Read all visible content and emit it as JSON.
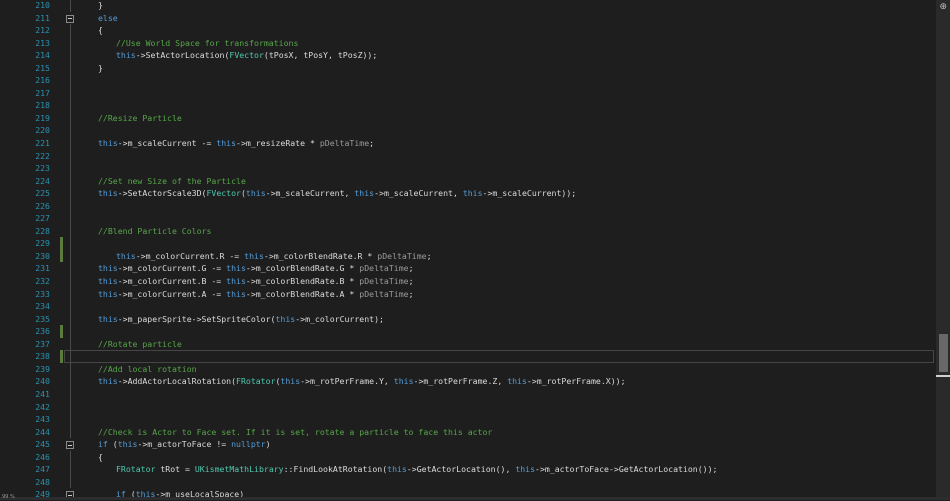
{
  "editor": {
    "lines": [
      {
        "n": "210",
        "fold": "",
        "guide": true,
        "changed": false,
        "current": false,
        "indent": 0,
        "tokens": [
          [
            "p",
            "}"
          ]
        ]
      },
      {
        "n": "211",
        "fold": "-",
        "guide": false,
        "changed": false,
        "current": false,
        "indent": 0,
        "tokens": [
          [
            "k",
            "else"
          ]
        ]
      },
      {
        "n": "212",
        "fold": "",
        "guide": true,
        "changed": false,
        "current": false,
        "indent": 0,
        "tokens": [
          [
            "p",
            "{"
          ]
        ]
      },
      {
        "n": "213",
        "fold": "",
        "guide": true,
        "changed": false,
        "current": false,
        "indent": 1,
        "tokens": [
          [
            "c",
            "//Use World Space for transformations"
          ]
        ]
      },
      {
        "n": "214",
        "fold": "",
        "guide": true,
        "changed": false,
        "current": false,
        "indent": 1,
        "tokens": [
          [
            "k",
            "this"
          ],
          [
            "p",
            "->"
          ],
          [
            "f",
            "SetActorLocation"
          ],
          [
            "p",
            "("
          ],
          [
            "t",
            "FVector"
          ],
          [
            "p",
            "(tPosX, tPosY, tPosZ));"
          ]
        ]
      },
      {
        "n": "215",
        "fold": "",
        "guide": true,
        "changed": false,
        "current": false,
        "indent": 0,
        "tokens": [
          [
            "p",
            "}"
          ]
        ]
      },
      {
        "n": "216",
        "fold": "",
        "guide": true,
        "changed": false,
        "current": false,
        "indent": 0,
        "tokens": []
      },
      {
        "n": "217",
        "fold": "",
        "guide": true,
        "changed": false,
        "current": false,
        "indent": 0,
        "tokens": []
      },
      {
        "n": "218",
        "fold": "",
        "guide": true,
        "changed": false,
        "current": false,
        "indent": 0,
        "tokens": []
      },
      {
        "n": "219",
        "fold": "",
        "guide": true,
        "changed": false,
        "current": false,
        "indent": 0,
        "tokens": [
          [
            "c",
            "//Resize Particle"
          ]
        ]
      },
      {
        "n": "220",
        "fold": "",
        "guide": true,
        "changed": false,
        "current": false,
        "indent": 0,
        "tokens": []
      },
      {
        "n": "221",
        "fold": "",
        "guide": true,
        "changed": false,
        "current": false,
        "indent": 0,
        "tokens": [
          [
            "k",
            "this"
          ],
          [
            "p",
            "->"
          ],
          [
            "m",
            "m_scaleCurrent"
          ],
          [
            "p",
            " -= "
          ],
          [
            "k",
            "this"
          ],
          [
            "p",
            "->"
          ],
          [
            "m",
            "m_resizeRate"
          ],
          [
            "p",
            " * "
          ],
          [
            "a",
            "pDeltaTime"
          ],
          [
            "p",
            ";"
          ]
        ]
      },
      {
        "n": "222",
        "fold": "",
        "guide": true,
        "changed": false,
        "current": false,
        "indent": 0,
        "tokens": []
      },
      {
        "n": "223",
        "fold": "",
        "guide": true,
        "changed": false,
        "current": false,
        "indent": 0,
        "tokens": []
      },
      {
        "n": "224",
        "fold": "",
        "guide": true,
        "changed": false,
        "current": false,
        "indent": 0,
        "tokens": [
          [
            "c",
            "//Set new Size of the Particle"
          ]
        ]
      },
      {
        "n": "225",
        "fold": "",
        "guide": true,
        "changed": false,
        "current": false,
        "indent": 0,
        "tokens": [
          [
            "k",
            "this"
          ],
          [
            "p",
            "->"
          ],
          [
            "f",
            "SetActorScale3D"
          ],
          [
            "p",
            "("
          ],
          [
            "t",
            "FVector"
          ],
          [
            "p",
            "("
          ],
          [
            "k",
            "this"
          ],
          [
            "p",
            "->"
          ],
          [
            "m",
            "m_scaleCurrent"
          ],
          [
            "p",
            ", "
          ],
          [
            "k",
            "this"
          ],
          [
            "p",
            "->"
          ],
          [
            "m",
            "m_scaleCurrent"
          ],
          [
            "p",
            ", "
          ],
          [
            "k",
            "this"
          ],
          [
            "p",
            "->"
          ],
          [
            "m",
            "m_scaleCurrent"
          ],
          [
            "p",
            "));"
          ]
        ]
      },
      {
        "n": "226",
        "fold": "",
        "guide": true,
        "changed": false,
        "current": false,
        "indent": 0,
        "tokens": []
      },
      {
        "n": "227",
        "fold": "",
        "guide": true,
        "changed": false,
        "current": false,
        "indent": 0,
        "tokens": []
      },
      {
        "n": "228",
        "fold": "",
        "guide": true,
        "changed": false,
        "current": false,
        "indent": 0,
        "tokens": [
          [
            "c",
            "//Blend Particle Colors"
          ]
        ]
      },
      {
        "n": "229",
        "fold": "",
        "guide": true,
        "changed": true,
        "current": false,
        "indent": 0,
        "tokens": []
      },
      {
        "n": "230",
        "fold": "",
        "guide": true,
        "changed": true,
        "current": false,
        "indent": 1,
        "tokens": [
          [
            "k",
            "this"
          ],
          [
            "p",
            "->"
          ],
          [
            "m",
            "m_colorCurrent"
          ],
          [
            "p",
            ".R -= "
          ],
          [
            "k",
            "this"
          ],
          [
            "p",
            "->"
          ],
          [
            "m",
            "m_colorBlendRate"
          ],
          [
            "p",
            ".R * "
          ],
          [
            "a",
            "pDeltaTime"
          ],
          [
            "p",
            ";"
          ]
        ]
      },
      {
        "n": "231",
        "fold": "",
        "guide": true,
        "changed": false,
        "current": false,
        "indent": 0,
        "tokens": [
          [
            "k",
            "this"
          ],
          [
            "p",
            "->"
          ],
          [
            "m",
            "m_colorCurrent"
          ],
          [
            "p",
            ".G -= "
          ],
          [
            "k",
            "this"
          ],
          [
            "p",
            "->"
          ],
          [
            "m",
            "m_colorBlendRate"
          ],
          [
            "p",
            ".G * "
          ],
          [
            "a",
            "pDeltaTime"
          ],
          [
            "p",
            ";"
          ]
        ]
      },
      {
        "n": "232",
        "fold": "",
        "guide": true,
        "changed": false,
        "current": false,
        "indent": 0,
        "tokens": [
          [
            "k",
            "this"
          ],
          [
            "p",
            "->"
          ],
          [
            "m",
            "m_colorCurrent"
          ],
          [
            "p",
            ".B -= "
          ],
          [
            "k",
            "this"
          ],
          [
            "p",
            "->"
          ],
          [
            "m",
            "m_colorBlendRate"
          ],
          [
            "p",
            ".B * "
          ],
          [
            "a",
            "pDeltaTime"
          ],
          [
            "p",
            ";"
          ]
        ]
      },
      {
        "n": "233",
        "fold": "",
        "guide": true,
        "changed": false,
        "current": false,
        "indent": 0,
        "tokens": [
          [
            "k",
            "this"
          ],
          [
            "p",
            "->"
          ],
          [
            "m",
            "m_colorCurrent"
          ],
          [
            "p",
            ".A -= "
          ],
          [
            "k",
            "this"
          ],
          [
            "p",
            "->"
          ],
          [
            "m",
            "m_colorBlendRate"
          ],
          [
            "p",
            ".A * "
          ],
          [
            "a",
            "pDeltaTime"
          ],
          [
            "p",
            ";"
          ]
        ]
      },
      {
        "n": "234",
        "fold": "",
        "guide": true,
        "changed": false,
        "current": false,
        "indent": 0,
        "tokens": []
      },
      {
        "n": "235",
        "fold": "",
        "guide": true,
        "changed": false,
        "current": false,
        "indent": 0,
        "tokens": [
          [
            "k",
            "this"
          ],
          [
            "p",
            "->"
          ],
          [
            "m",
            "m_paperSprite"
          ],
          [
            "p",
            "->"
          ],
          [
            "f",
            "SetSpriteColor"
          ],
          [
            "p",
            "("
          ],
          [
            "k",
            "this"
          ],
          [
            "p",
            "->"
          ],
          [
            "m",
            "m_colorCurrent"
          ],
          [
            "p",
            ");"
          ]
        ]
      },
      {
        "n": "236",
        "fold": "",
        "guide": true,
        "changed": true,
        "current": false,
        "indent": 0,
        "tokens": []
      },
      {
        "n": "237",
        "fold": "",
        "guide": true,
        "changed": false,
        "current": false,
        "indent": 0,
        "tokens": [
          [
            "c",
            "//Rotate particle"
          ]
        ]
      },
      {
        "n": "238",
        "fold": "",
        "guide": true,
        "changed": true,
        "current": true,
        "indent": 0,
        "tokens": []
      },
      {
        "n": "239",
        "fold": "",
        "guide": true,
        "changed": false,
        "current": false,
        "indent": 0,
        "tokens": [
          [
            "c",
            "//Add local rotation"
          ]
        ]
      },
      {
        "n": "240",
        "fold": "",
        "guide": true,
        "changed": false,
        "current": false,
        "indent": 0,
        "tokens": [
          [
            "k",
            "this"
          ],
          [
            "p",
            "->"
          ],
          [
            "f",
            "AddActorLocalRotation"
          ],
          [
            "p",
            "("
          ],
          [
            "t",
            "FRotator"
          ],
          [
            "p",
            "("
          ],
          [
            "k",
            "this"
          ],
          [
            "p",
            "->"
          ],
          [
            "m",
            "m_rotPerFrame"
          ],
          [
            "p",
            ".Y, "
          ],
          [
            "k",
            "this"
          ],
          [
            "p",
            "->"
          ],
          [
            "m",
            "m_rotPerFrame"
          ],
          [
            "p",
            ".Z, "
          ],
          [
            "k",
            "this"
          ],
          [
            "p",
            "->"
          ],
          [
            "m",
            "m_rotPerFrame"
          ],
          [
            "p",
            ".X));"
          ]
        ]
      },
      {
        "n": "241",
        "fold": "",
        "guide": true,
        "changed": false,
        "current": false,
        "indent": 0,
        "tokens": []
      },
      {
        "n": "242",
        "fold": "",
        "guide": true,
        "changed": false,
        "current": false,
        "indent": 0,
        "tokens": []
      },
      {
        "n": "243",
        "fold": "",
        "guide": true,
        "changed": false,
        "current": false,
        "indent": 0,
        "tokens": []
      },
      {
        "n": "244",
        "fold": "",
        "guide": true,
        "changed": false,
        "current": false,
        "indent": 0,
        "tokens": [
          [
            "c",
            "//Check is Actor to Face set. If it is set, rotate a particle to face this actor"
          ]
        ]
      },
      {
        "n": "245",
        "fold": "-",
        "guide": false,
        "changed": false,
        "current": false,
        "indent": 0,
        "tokens": [
          [
            "k",
            "if"
          ],
          [
            "p",
            " ("
          ],
          [
            "k",
            "this"
          ],
          [
            "p",
            "->"
          ],
          [
            "m",
            "m_actorToFace"
          ],
          [
            "p",
            " != "
          ],
          [
            "k",
            "nullptr"
          ],
          [
            "p",
            ")"
          ]
        ]
      },
      {
        "n": "246",
        "fold": "",
        "guide": true,
        "changed": false,
        "current": false,
        "indent": 0,
        "tokens": [
          [
            "p",
            "{"
          ]
        ]
      },
      {
        "n": "247",
        "fold": "",
        "guide": true,
        "changed": false,
        "current": false,
        "indent": 1,
        "tokens": [
          [
            "t",
            "FRotator"
          ],
          [
            "p",
            " tRot = "
          ],
          [
            "t",
            "UKismetMathLibrary"
          ],
          [
            "p",
            "::"
          ],
          [
            "f",
            "FindLookAtRotation"
          ],
          [
            "p",
            "("
          ],
          [
            "k",
            "this"
          ],
          [
            "p",
            "->"
          ],
          [
            "f",
            "GetActorLocation"
          ],
          [
            "p",
            "(), "
          ],
          [
            "k",
            "this"
          ],
          [
            "p",
            "->"
          ],
          [
            "m",
            "m_actorToFace"
          ],
          [
            "p",
            "->"
          ],
          [
            "f",
            "GetActorLocation"
          ],
          [
            "p",
            "());"
          ]
        ]
      },
      {
        "n": "248",
        "fold": "",
        "guide": true,
        "changed": false,
        "current": false,
        "indent": 0,
        "tokens": []
      },
      {
        "n": "249",
        "fold": "-",
        "guide": false,
        "changed": false,
        "current": false,
        "indent": 1,
        "tokens": [
          [
            "k",
            "if"
          ],
          [
            "p",
            " ("
          ],
          [
            "k",
            "this"
          ],
          [
            "p",
            "->"
          ],
          [
            "m",
            "m_useLocalSpace"
          ],
          [
            "p",
            ")"
          ]
        ]
      }
    ]
  },
  "colors": {
    "background": "#1e1e1e",
    "line_number": "#2b91af",
    "keyword": "#569cd6",
    "comment": "#57a64a",
    "type": "#4ec9b0",
    "plain": "#dcdcdc",
    "parameter": "#9a9a9a",
    "change_marker": "#5d7b3c"
  },
  "icons": {
    "fold": "minus-box-icon",
    "scroll_up": "arrow-up-icon"
  },
  "scrollbar": {
    "up_glyph": "⊕"
  },
  "status": {
    "label": "99 %"
  }
}
